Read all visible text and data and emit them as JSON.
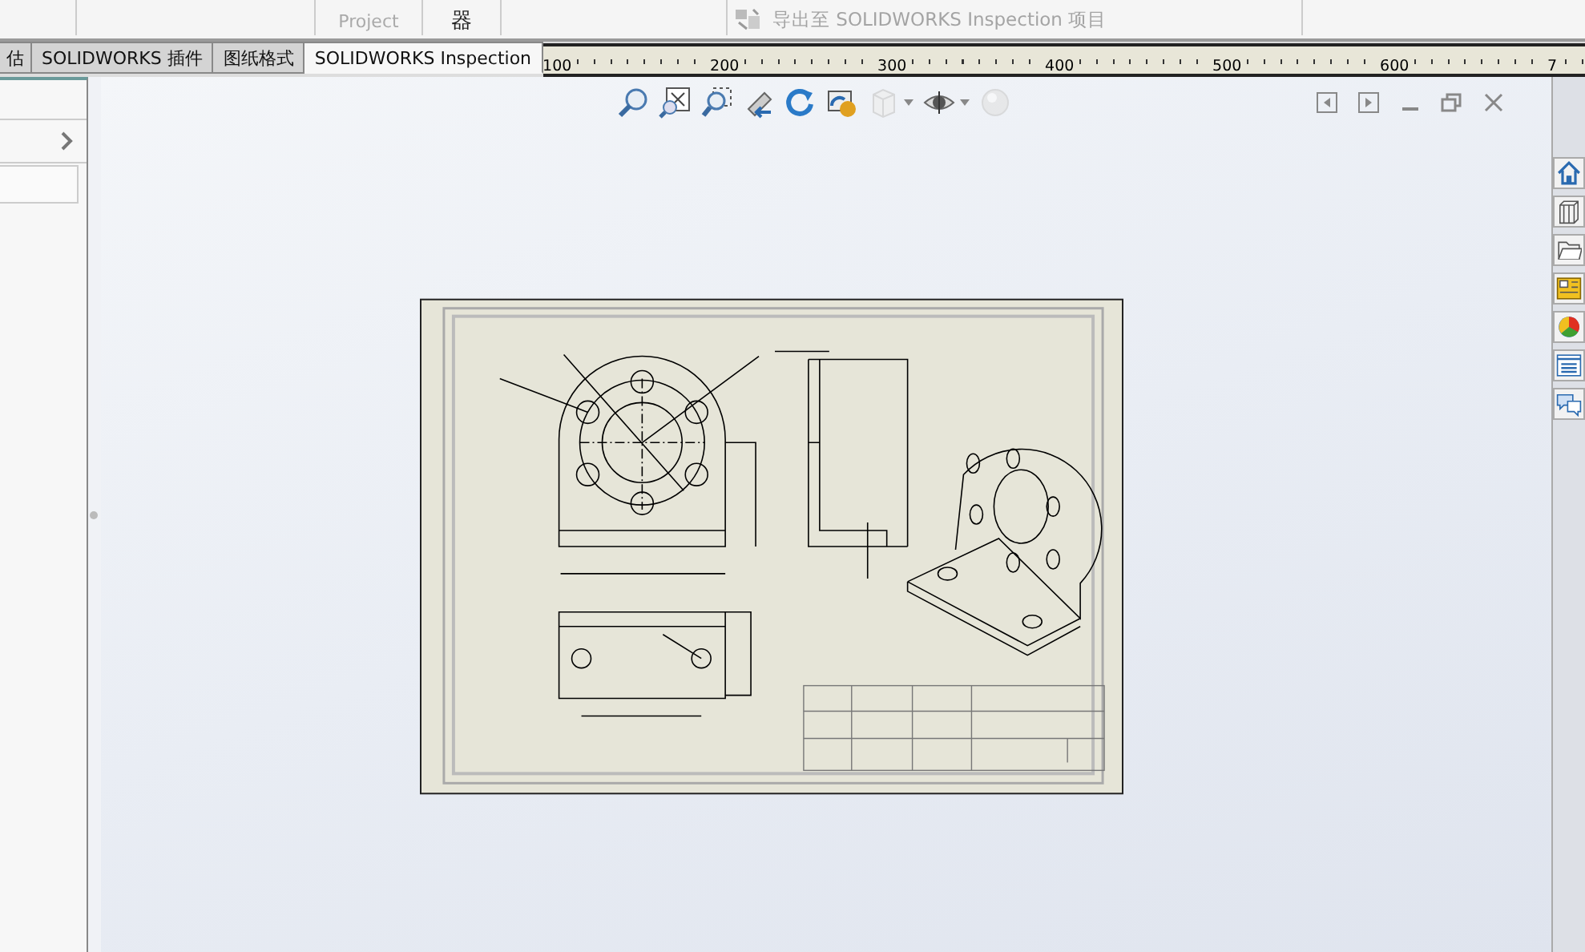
{
  "toolbar": {
    "partial_labels": [
      "Project",
      "器"
    ],
    "export_button": {
      "label": "导出至 SOLIDWORKS Inspection 项目",
      "disabled": true
    }
  },
  "tabs": [
    {
      "label": "估",
      "selected": false
    },
    {
      "label": "SOLIDWORKS 插件",
      "selected": false
    },
    {
      "label": "图纸格式",
      "selected": false
    },
    {
      "label": "SOLIDWORKS Inspection",
      "selected": true
    }
  ],
  "ruler": {
    "labels": [
      "100",
      "200",
      "300",
      "400",
      "500",
      "600",
      "7"
    ]
  }
}
